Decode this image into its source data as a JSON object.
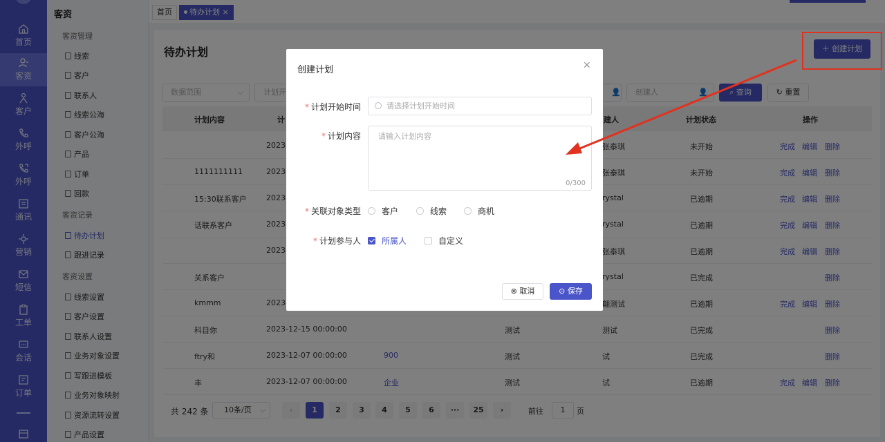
{
  "nav": [
    {
      "label": "首页",
      "icon": "home-icon"
    },
    {
      "label": "客资",
      "icon": "customer-resource-icon"
    },
    {
      "label": "客户",
      "icon": "customer-icon"
    },
    {
      "label": "外呼",
      "icon": "phone-icon"
    },
    {
      "label": "外呼",
      "icon": "phone-out-icon"
    },
    {
      "label": "通讯",
      "icon": "contact-book-icon"
    },
    {
      "label": "营销",
      "icon": "marketing-icon"
    },
    {
      "label": "短信",
      "icon": "sms-icon"
    },
    {
      "label": "工单",
      "icon": "clipboard-icon"
    },
    {
      "label": "会话",
      "icon": "chat-icon"
    },
    {
      "label": "订单",
      "icon": "order-icon"
    }
  ],
  "submenu": {
    "title": "客资",
    "groups": [
      "客资管理",
      "客资记录",
      "客资设置"
    ],
    "items": [
      "线索",
      "客户",
      "联系人",
      "线索公海",
      "客户公海",
      "产品",
      "订单",
      "回款",
      "待办计划",
      "跟进记录",
      "线索设置",
      "客户设置",
      "联系人设置",
      "业务对象设置",
      "写跟进模板",
      "业务对象映射",
      "资源流转设置",
      "产品设置"
    ]
  },
  "tabs": [
    "首页",
    "待办计划"
  ],
  "page": {
    "title": "待办计划",
    "create_label": "创建计划",
    "filters": {
      "range": "数据范围",
      "plan_start": "计划开",
      "creator": "创建人"
    },
    "query_label": "查询",
    "reset_label": "重置"
  },
  "table": {
    "headers": [
      "计划内容",
      "计",
      "建人",
      "计划状态",
      "操作"
    ],
    "rows": [
      {
        "content": "",
        "date": "2023-",
        "creator": "张泰琪",
        "status": "未开始",
        "ops": [
          "完成",
          "编辑",
          "删除"
        ]
      },
      {
        "content": "1111111111",
        "date": "2023-",
        "creator": "张泰琪",
        "status": "未开始",
        "ops": [
          "完成",
          "编辑",
          "删除"
        ]
      },
      {
        "content": "15:30联系客户",
        "date": "2023-",
        "creator": "rystal",
        "status": "已逾期",
        "ops": [
          "完成",
          "编辑",
          "删除"
        ]
      },
      {
        "content": "话联系客户",
        "date": "2023-",
        "creator": "rystal",
        "status": "已逾期",
        "ops": [
          "完成",
          "编辑",
          "删除"
        ]
      },
      {
        "content": "",
        "date": "2023-",
        "creator": "张泰琪",
        "status": "已逾期",
        "ops": [
          "完成",
          "编辑",
          "删除"
        ]
      },
      {
        "content": "关系客户",
        "date": "",
        "creator": "rystal",
        "status": "已完成",
        "ops": [
          "删除"
        ]
      },
      {
        "content": "kmmm",
        "date": "2023-",
        "creator": "翩测试",
        "status": "已逾期",
        "ops": [
          "完成",
          "编辑",
          "删除"
        ]
      },
      {
        "content": "科目你",
        "date": "2023-12-15 00:00:00",
        "related": "",
        "owner": "测试",
        "creator": "测试",
        "status": "已完成",
        "ops": [
          "删除"
        ]
      },
      {
        "content": "ftry和",
        "date": "2023-12-07 00:00:00",
        "related": "900",
        "owner": "测试",
        "creator": "试",
        "status": "已完成",
        "ops": [
          "删除"
        ]
      },
      {
        "content": "丰",
        "date": "2023-12-07 00:00:00",
        "related": "企业",
        "owner": "测试",
        "creator": "试",
        "status": "已逾期",
        "ops": [
          "完成",
          "编辑",
          "删除"
        ]
      }
    ]
  },
  "pagination": {
    "total": "共 242 条",
    "page_size": "10条/页",
    "pages": [
      "1",
      "2",
      "3",
      "4",
      "5",
      "6",
      "···",
      "25"
    ],
    "goto_prefix": "前往",
    "goto_value": "1",
    "goto_suffix": "页"
  },
  "modal": {
    "title": "创建计划",
    "start_label": "计划开始时间",
    "start_placeholder": "请选择计划开始时间",
    "content_label": "计划内容",
    "content_placeholder": "请输入计划内容",
    "counter": "0/300",
    "type_label": "关联对象类型",
    "types": [
      "客户",
      "线索",
      "商机"
    ],
    "participant_label": "计划参与人",
    "participants": [
      "所属人",
      "自定义"
    ],
    "cancel_label": "取消",
    "save_label": "保存"
  },
  "colors": {
    "accent": "#4a55c9",
    "annotation": "#e0321f"
  }
}
